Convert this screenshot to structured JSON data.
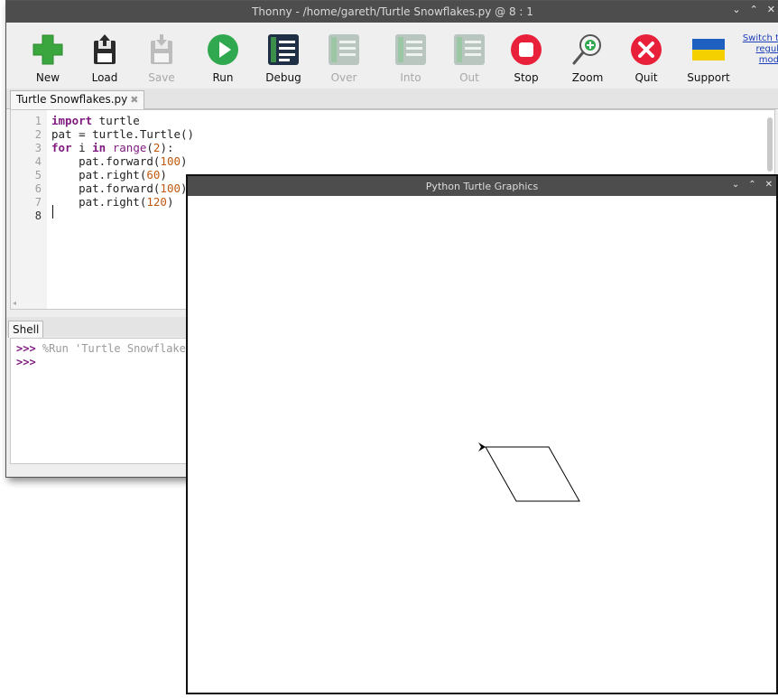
{
  "thonny": {
    "title": "Thonny  -  /home/gareth/Turtle Snowflakes.py  @  8 : 1",
    "window_controls": [
      "⌄",
      "⌃",
      "✕"
    ],
    "toolbar": [
      {
        "label": "New",
        "icon": "new-plus-icon",
        "enabled": true
      },
      {
        "label": "Load",
        "icon": "load-icon",
        "enabled": true
      },
      {
        "label": "Save",
        "icon": "save-icon",
        "enabled": false
      },
      {
        "label": "Run",
        "icon": "run-icon",
        "enabled": true
      },
      {
        "label": "Debug",
        "icon": "debug-icon",
        "enabled": true
      },
      {
        "label": "Over",
        "icon": "step-over-icon",
        "enabled": false
      },
      {
        "label": "Into",
        "icon": "step-into-icon",
        "enabled": false
      },
      {
        "label": "Out",
        "icon": "step-out-icon",
        "enabled": false
      },
      {
        "label": "Stop",
        "icon": "stop-icon",
        "enabled": true
      },
      {
        "label": "Zoom",
        "icon": "zoom-icon",
        "enabled": true
      },
      {
        "label": "Quit",
        "icon": "quit-icon",
        "enabled": true
      },
      {
        "label": "Support",
        "icon": "ukraine-flag-icon",
        "enabled": true
      }
    ],
    "switch_link": [
      "Switch t",
      "regul",
      "mod"
    ],
    "editor_tab": "Turtle Snowflakes.py",
    "editor_tab_close": "✖",
    "line_numbers": [
      "1",
      "2",
      "3",
      "4",
      "5",
      "6",
      "7",
      "8"
    ],
    "shell_tab": "Shell",
    "shell": {
      "prompt": ">>>",
      "run_command": "%Run 'Turtle Snowflakes.py'"
    }
  },
  "turtle": {
    "title": "Python Turtle Graphics",
    "window_controls": [
      "⌄",
      "⌃",
      "✕"
    ],
    "drawing": {
      "shape": "parallelogram",
      "side_lengths": [
        100,
        100
      ],
      "turn_angles_deg": [
        60,
        120
      ],
      "stroke_color": "#000000"
    }
  },
  "colors": {
    "run_green": "#2fa84f",
    "stop_red": "#e8203a",
    "keyword_purple": "#7f1a7f",
    "number_orange": "#c05a10",
    "debug_blue": "#2d5d9e"
  }
}
